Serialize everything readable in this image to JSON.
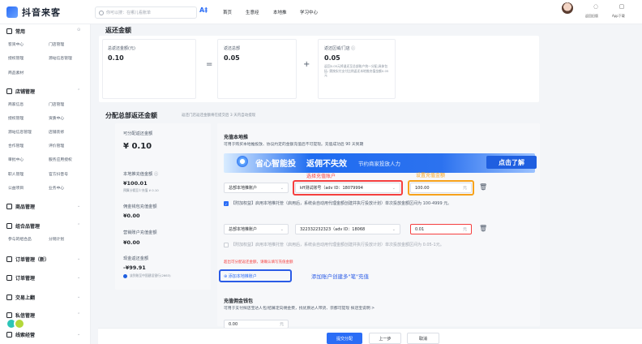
{
  "brand": {
    "name": "抖音来客",
    "color": "#2b6df6"
  },
  "search": {
    "placeholder": "你可以搜：在哪儿看账单"
  },
  "ai_icon": "A‡",
  "topnav": [
    "首页",
    "生意经",
    "本地推",
    "学习中心"
  ],
  "user_actions": [
    {
      "icon": "help-icon",
      "glyph": "◌",
      "label": "返回旧版"
    },
    {
      "icon": "app-icon",
      "glyph": "▢",
      "label": "App下载"
    }
  ],
  "sidebar": {
    "common": {
      "title": "常用",
      "items": [
        "客资中心",
        "门店管理",
        "授权管理",
        "源站信息管理",
        "商品素材"
      ]
    },
    "store": {
      "title": "店铺管理",
      "items": [
        "商家信息",
        "门店管理",
        "授权管理",
        "资质中心",
        "源站信息管理",
        "店铺装修",
        "合作管理",
        "评价管理",
        "审批中心",
        "服务应用授权",
        "职人管理",
        "官方抖音号",
        "公益项目",
        "业务中心"
      ]
    },
    "groups": [
      {
        "title": "商品管理"
      },
      {
        "title": "组合品管理",
        "items": [
          "参与的组合品",
          "分销计划"
        ]
      },
      {
        "title": "订单管理（新）"
      },
      {
        "title": "订单管理"
      },
      {
        "title": "交易上翻"
      },
      {
        "title": "私信管理"
      },
      {
        "title": "线索经营"
      }
    ]
  },
  "rebate": {
    "title": "返还金额",
    "total": {
      "label": "总返还金额(元)",
      "value": "0.10"
    },
    "hq": {
      "label": "返还总部",
      "value": "0.05"
    },
    "store": {
      "label": "返还区域/门店 ⓘ",
      "value": "0.05",
      "note": "返回0.05元将退还至总部账户统一分配,具体包括: 需按实付支付比例返还本地推充值金额0.05元"
    },
    "eq": "=",
    "plus": "+"
  },
  "allocation": {
    "title": "分配总部返还金额",
    "subtitle": "返还门店返还金额将在提交后 3 天内自动提现",
    "left": {
      "allocatable_label": "可分配返还金额",
      "allocatable_value": "¥ 0.10",
      "local_label": "本地推充值金额 ⓘ",
      "local_value": "¥100.01",
      "local_note": "预算分佣至少充值 ¥ 0.10",
      "comm_label": "佣金钱包充值金额",
      "comm_value": "¥0.00",
      "marketing_label": "营销账户充值金额",
      "marketing_value": "¥0.00",
      "cash_label": "现金返还金额",
      "cash_value": "-¥99.91",
      "bank_note": "该到账至中国建设银行(2663)"
    },
    "right": {
      "section_title": "充值本地推",
      "section_desc": "可用于购买本地推投放、协议约定的金额充值后不可提现。充值成功后 90 天到期",
      "banner": {
        "text1": "省心智能投",
        "text2": "返佣不失效",
        "text3": "节约商家投放人力",
        "button": "点击了解"
      },
      "annot_select_account": "选择充值账户",
      "annot_set_amount": "设置充值金额",
      "rows": [
        {
          "type": "总部本地推账户",
          "account": "kff测试账号（adv ID：18079994",
          "amount": "100.00",
          "unit": "元",
          "checkbox_text": "【附加权益】启用本地推托管（启用后，系统会自动用代理金额创建并执行投放计划）单次投放金额区间为 100-4999 元。"
        },
        {
          "type": "总部本地推账户",
          "account": "322332232323（adv ID：18068",
          "amount": "0.01",
          "unit": "元",
          "checkbox_text": "【附加权益】启用本地推托管（启用后，系统会自动用代理金额创建并执行投放计划）单次投放金额区间为 0.05-1元。"
        }
      ],
      "error_text": "超出可分配返还金额，请确认填写充值金额",
      "add_account": "⊕ 添加本地推账户",
      "annot_add": "添加账户创建多\"笔\"充值",
      "commission_title": "充值佣金钱包",
      "commission_desc": "可用于支付探店宝达人包/招募定向佣金费，找优质达人带货、宗都可提现 探店宝说明 >",
      "commission_value": "0.00",
      "commission_unit": "元"
    }
  },
  "footer": {
    "submit": "提交分配",
    "prev": "上一步",
    "cancel": "取消"
  },
  "colors": {
    "primary": "#2b6df6",
    "error": "#f53f3f",
    "warning": "#f7a21b"
  }
}
